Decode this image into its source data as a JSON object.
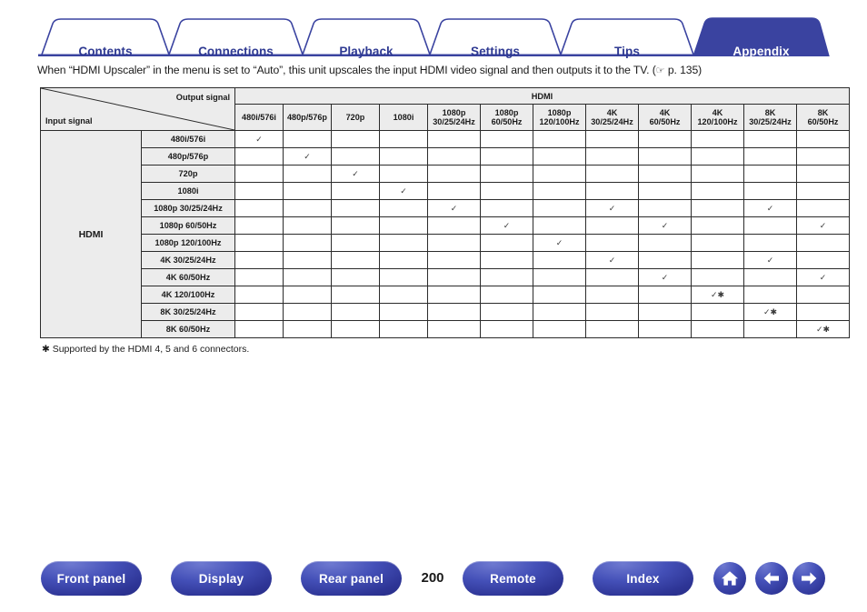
{
  "tabs": [
    {
      "label": "Contents",
      "active": false
    },
    {
      "label": "Connections",
      "active": false
    },
    {
      "label": "Playback",
      "active": false
    },
    {
      "label": "Settings",
      "active": false
    },
    {
      "label": "Tips",
      "active": false
    },
    {
      "label": "Appendix",
      "active": true
    }
  ],
  "intro": {
    "text_before": "When “HDMI Upscaler” in the menu is set to “Auto”, this unit upscales the input HDMI video signal and then outputs it to the TV.  (",
    "pointer_icon": "☞",
    "text_after": " p. 135)"
  },
  "table": {
    "corner": {
      "output_label": "Output signal",
      "input_label": "Input signal"
    },
    "group_header": "HDMI",
    "row_group_label": "HDMI",
    "columns": [
      "480i/576i",
      "480p/576p",
      "720p",
      "1080i",
      "1080p\n30/25/24Hz",
      "1080p\n60/50Hz",
      "1080p\n120/100Hz",
      "4K\n30/25/24Hz",
      "4K\n60/50Hz",
      "4K\n120/100Hz",
      "8K\n30/25/24Hz",
      "8K\n60/50Hz"
    ],
    "rows": [
      {
        "label": "480i/576i",
        "marks": [
          1,
          0,
          0,
          0,
          0,
          0,
          0,
          0,
          0,
          0,
          0,
          0
        ],
        "asterisk": false
      },
      {
        "label": "480p/576p",
        "marks": [
          0,
          1,
          0,
          0,
          0,
          0,
          0,
          0,
          0,
          0,
          0,
          0
        ],
        "asterisk": false
      },
      {
        "label": "720p",
        "marks": [
          0,
          0,
          1,
          0,
          0,
          0,
          0,
          0,
          0,
          0,
          0,
          0
        ],
        "asterisk": false
      },
      {
        "label": "1080i",
        "marks": [
          0,
          0,
          0,
          1,
          0,
          0,
          0,
          0,
          0,
          0,
          0,
          0
        ],
        "asterisk": false
      },
      {
        "label": "1080p 30/25/24Hz",
        "marks": [
          0,
          0,
          0,
          0,
          1,
          0,
          0,
          1,
          0,
          0,
          1,
          0
        ],
        "asterisk": false
      },
      {
        "label": "1080p 60/50Hz",
        "marks": [
          0,
          0,
          0,
          0,
          0,
          1,
          0,
          0,
          1,
          0,
          0,
          1
        ],
        "asterisk": false
      },
      {
        "label": "1080p 120/100Hz",
        "marks": [
          0,
          0,
          0,
          0,
          0,
          0,
          1,
          0,
          0,
          0,
          0,
          0
        ],
        "asterisk": false
      },
      {
        "label": "4K 30/25/24Hz",
        "marks": [
          0,
          0,
          0,
          0,
          0,
          0,
          0,
          1,
          0,
          0,
          1,
          0
        ],
        "asterisk": false
      },
      {
        "label": "4K 60/50Hz",
        "marks": [
          0,
          0,
          0,
          0,
          0,
          0,
          0,
          0,
          1,
          0,
          0,
          1
        ],
        "asterisk": false
      },
      {
        "label": "4K 120/100Hz",
        "marks": [
          0,
          0,
          0,
          0,
          0,
          0,
          0,
          0,
          0,
          1,
          0,
          0
        ],
        "asterisk": true
      },
      {
        "label": "8K 30/25/24Hz",
        "marks": [
          0,
          0,
          0,
          0,
          0,
          0,
          0,
          0,
          0,
          0,
          1,
          0
        ],
        "asterisk": true
      },
      {
        "label": "8K 60/50Hz",
        "marks": [
          0,
          0,
          0,
          0,
          0,
          0,
          0,
          0,
          0,
          0,
          0,
          1
        ],
        "asterisk": true
      }
    ],
    "check_glyph": "✓",
    "asterisk_glyph": "✱"
  },
  "footnote": "✱ Supported by the HDMI 4, 5 and 6 connectors.",
  "bottom_nav": {
    "buttons": [
      {
        "label": "Front panel"
      },
      {
        "label": "Display"
      },
      {
        "label": "Rear panel"
      },
      {
        "label": "Remote"
      },
      {
        "label": "Index"
      }
    ],
    "page_number": "200",
    "icons": [
      {
        "name": "home-icon"
      },
      {
        "name": "back-arrow-icon"
      },
      {
        "name": "forward-arrow-icon"
      }
    ]
  },
  "colors": {
    "brand_blue": "#2f3a92",
    "active_tab": "#3a43a0",
    "header_gray": "#ececec",
    "border": "#2b2b2b"
  }
}
